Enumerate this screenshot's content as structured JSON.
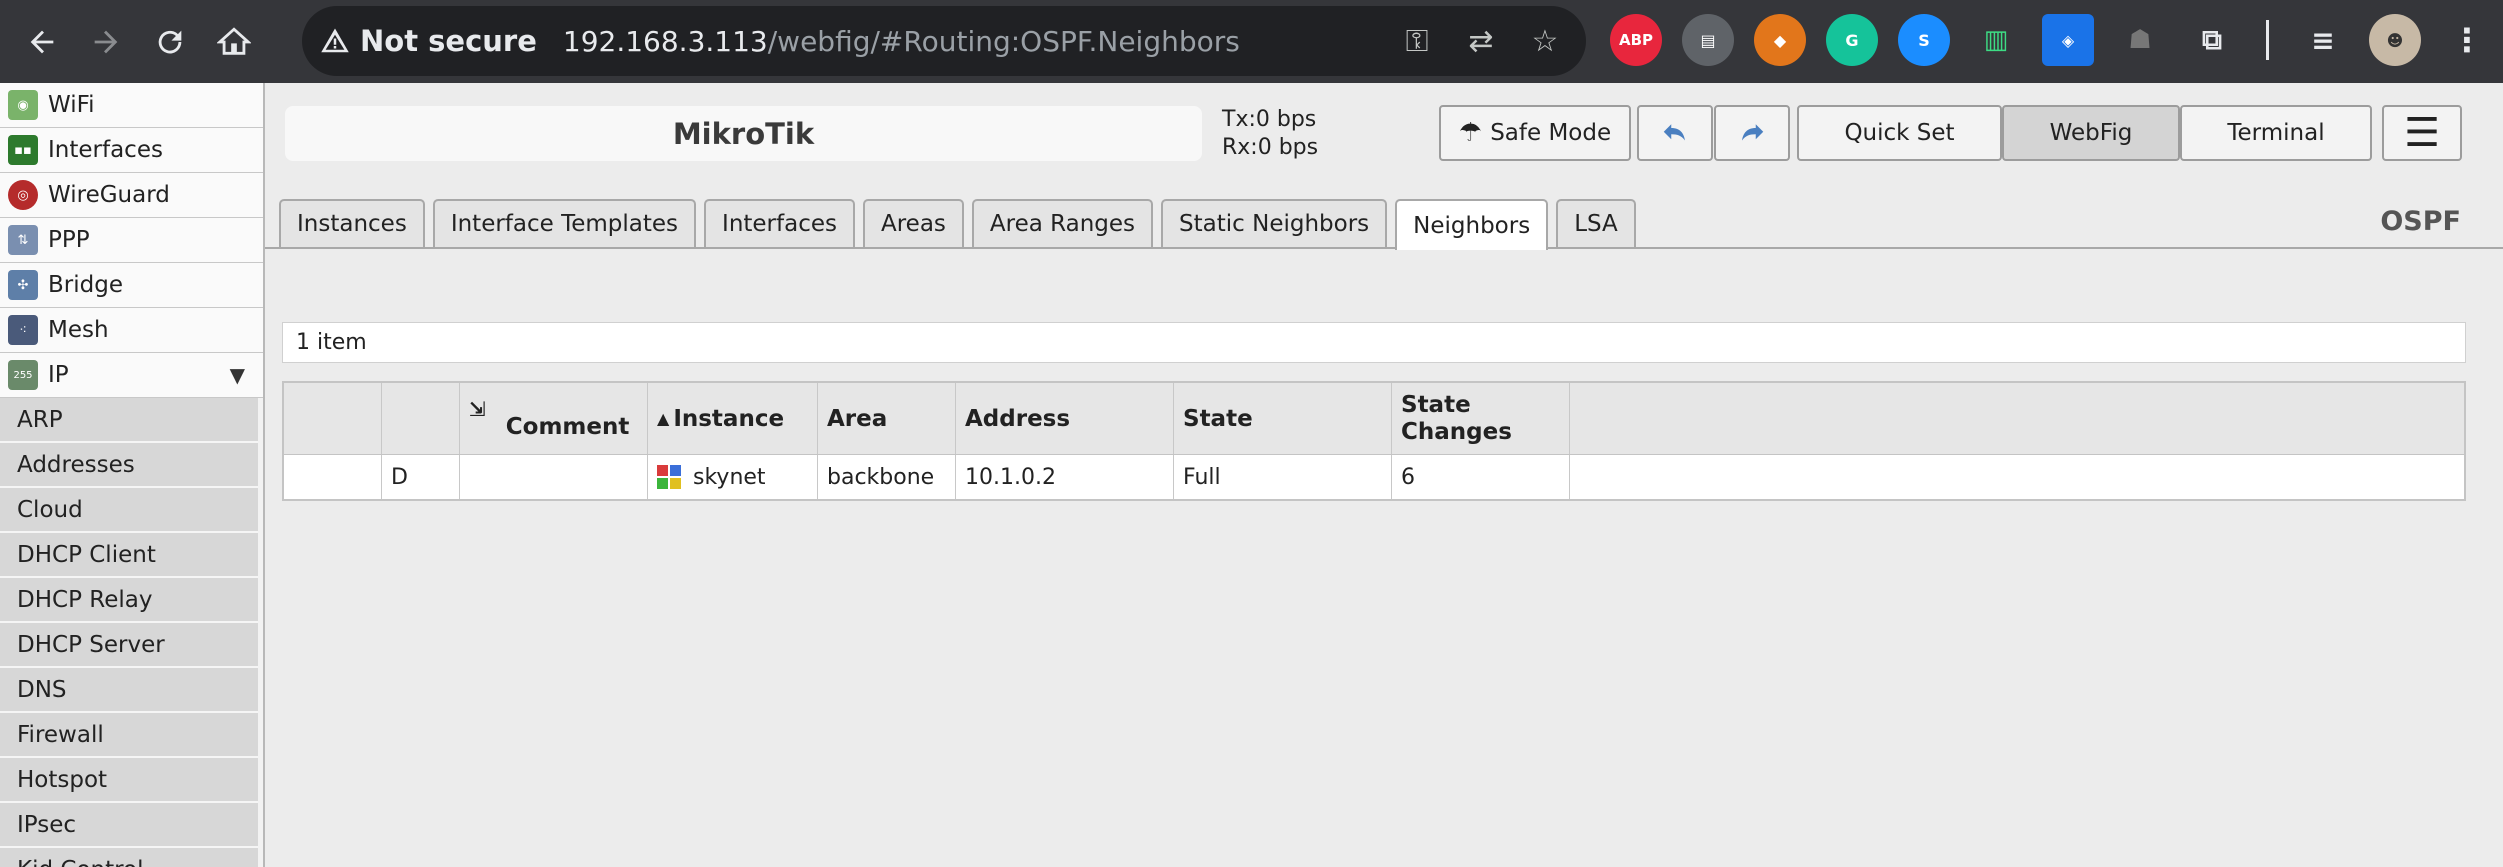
{
  "browser": {
    "security_label": "Not secure",
    "url_host": "192.168.3.113",
    "url_path": "/webfig/#Routing:OSPF.Neighbors",
    "ext_abp": "ABP"
  },
  "sidebar": {
    "items": [
      {
        "label": "WiFi",
        "icon": "wifi-icon"
      },
      {
        "label": "Interfaces",
        "icon": "interfaces-icon"
      },
      {
        "label": "WireGuard",
        "icon": "wireguard-icon"
      },
      {
        "label": "PPP",
        "icon": "ppp-icon"
      },
      {
        "label": "Bridge",
        "icon": "bridge-icon"
      },
      {
        "label": "Mesh",
        "icon": "mesh-icon"
      },
      {
        "label": "IP",
        "icon": "ip-icon",
        "expanded": true
      }
    ],
    "ip_subitems": [
      "ARP",
      "Addresses",
      "Cloud",
      "DHCP Client",
      "DHCP Relay",
      "DHCP Server",
      "DNS",
      "Firewall",
      "Hotspot",
      "IPsec",
      "Kid Control"
    ]
  },
  "header": {
    "title": "MikroTik",
    "tx": "Tx:0 bps",
    "rx": "Rx:0 bps",
    "safe_mode": "Safe Mode",
    "quick_set": "Quick Set",
    "webfig": "WebFig",
    "terminal": "Terminal"
  },
  "tabs": [
    {
      "label": "Instances",
      "active": false
    },
    {
      "label": "Interface Templates",
      "active": false
    },
    {
      "label": "Interfaces",
      "active": false
    },
    {
      "label": "Areas",
      "active": false
    },
    {
      "label": "Area Ranges",
      "active": false
    },
    {
      "label": "Static Neighbors",
      "active": false
    },
    {
      "label": "Neighbors",
      "active": true
    },
    {
      "label": "LSA",
      "active": false
    }
  ],
  "section_label": "OSPF",
  "list": {
    "count": "1 item",
    "columns": [
      "",
      "",
      "Comment",
      "Instance",
      "Area",
      "Address",
      "State",
      "State Changes",
      ""
    ],
    "sort_indicator": "▲",
    "rows": [
      {
        "flag": "D",
        "comment": "",
        "instance": "skynet",
        "area": "backbone",
        "address": "10.1.0.2",
        "state": "Full",
        "state_changes": "6"
      }
    ]
  }
}
